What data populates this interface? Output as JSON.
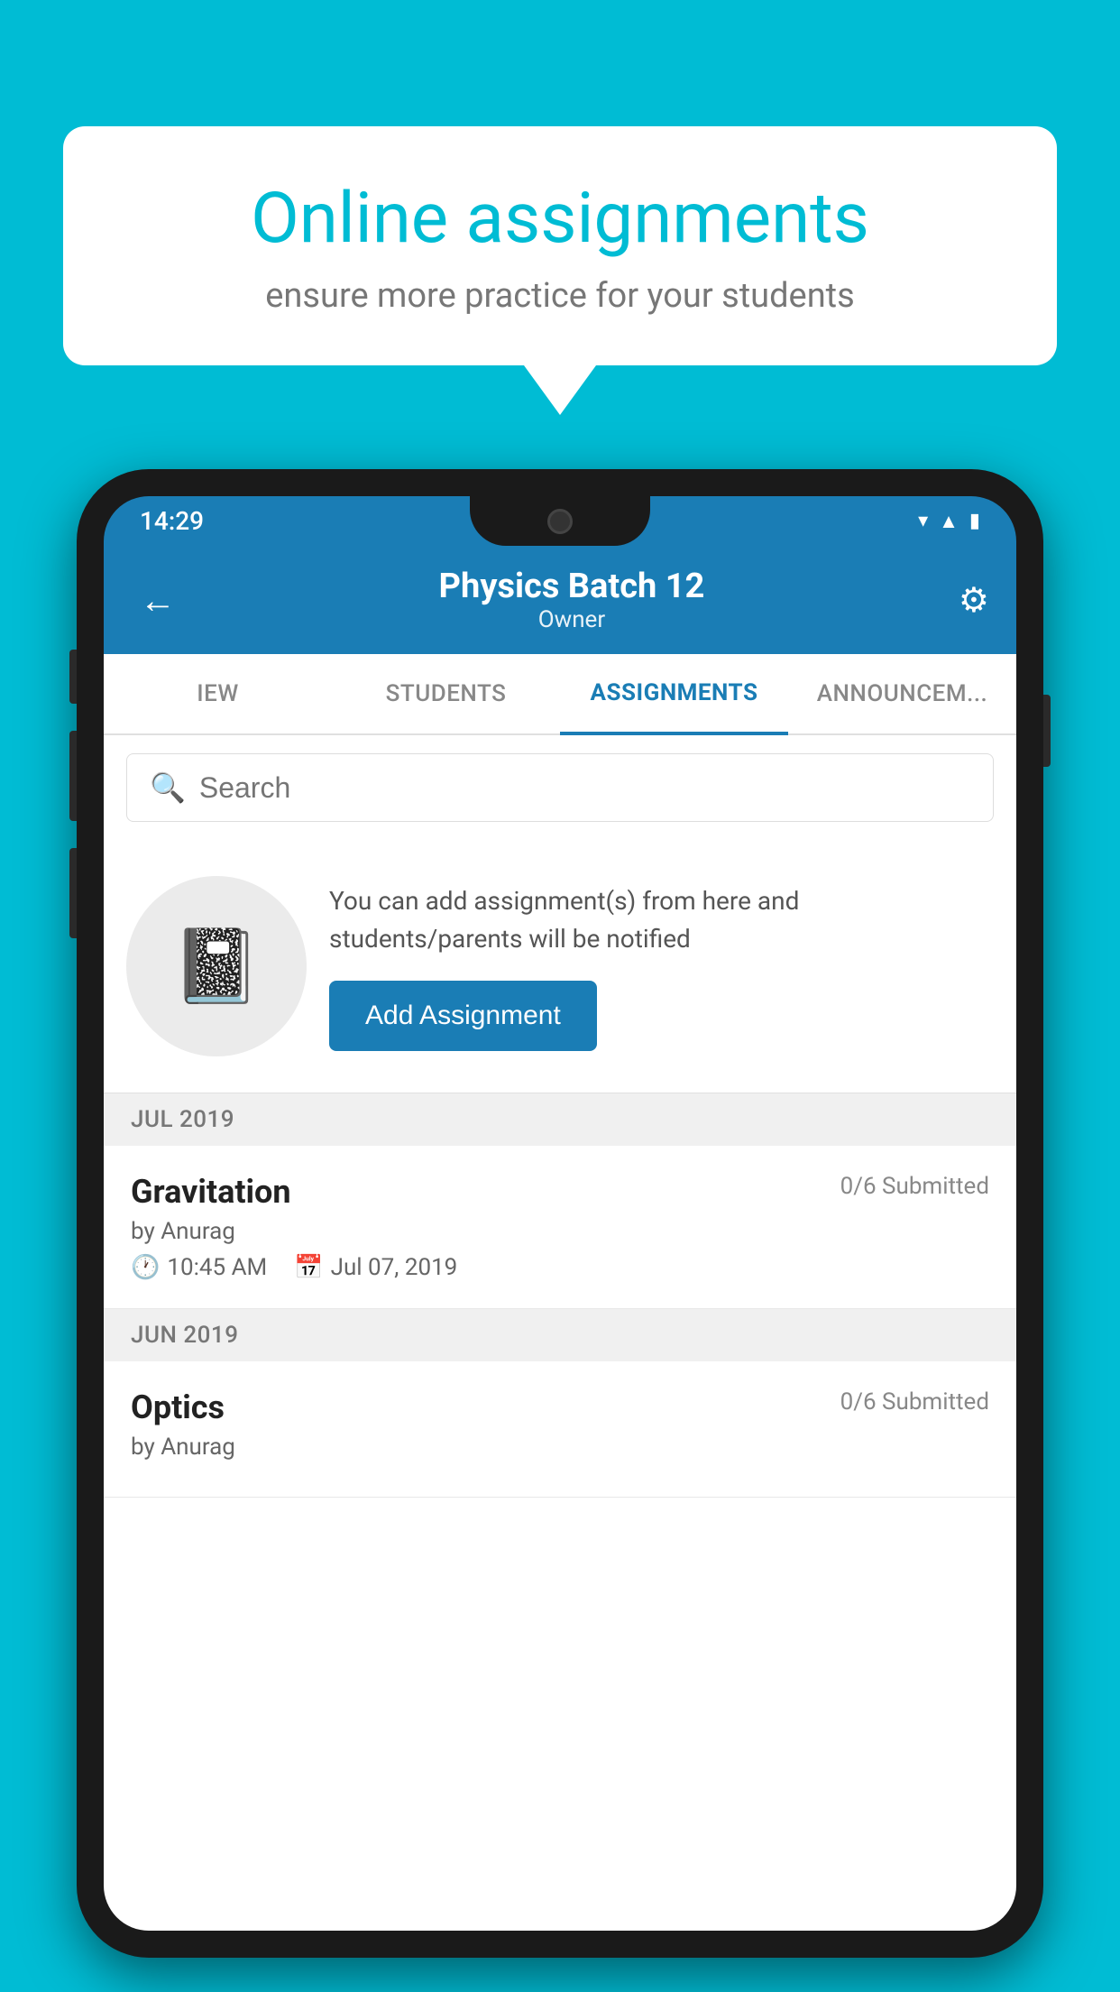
{
  "background_color": "#00BCD4",
  "speech_bubble": {
    "title": "Online assignments",
    "subtitle": "ensure more practice for your students"
  },
  "status_bar": {
    "time": "14:29",
    "icons": [
      "wifi",
      "signal",
      "battery"
    ]
  },
  "app_bar": {
    "title": "Physics Batch 12",
    "subtitle": "Owner",
    "back_icon": "←",
    "settings_icon": "⚙"
  },
  "tabs": [
    {
      "label": "IEW",
      "active": false
    },
    {
      "label": "STUDENTS",
      "active": false
    },
    {
      "label": "ASSIGNMENTS",
      "active": true
    },
    {
      "label": "ANNOUNCEM...",
      "active": false
    }
  ],
  "search": {
    "placeholder": "Search"
  },
  "info_section": {
    "description": "You can add assignment(s) from here and students/parents will be notified",
    "button_label": "Add Assignment"
  },
  "assignment_groups": [
    {
      "month_label": "JUL 2019",
      "assignments": [
        {
          "title": "Gravitation",
          "submitted": "0/6 Submitted",
          "author": "by Anurag",
          "time": "10:45 AM",
          "date": "Jul 07, 2019"
        }
      ]
    },
    {
      "month_label": "JUN 2019",
      "assignments": [
        {
          "title": "Optics",
          "submitted": "0/6 Submitted",
          "author": "by Anurag",
          "time": "",
          "date": ""
        }
      ]
    }
  ]
}
